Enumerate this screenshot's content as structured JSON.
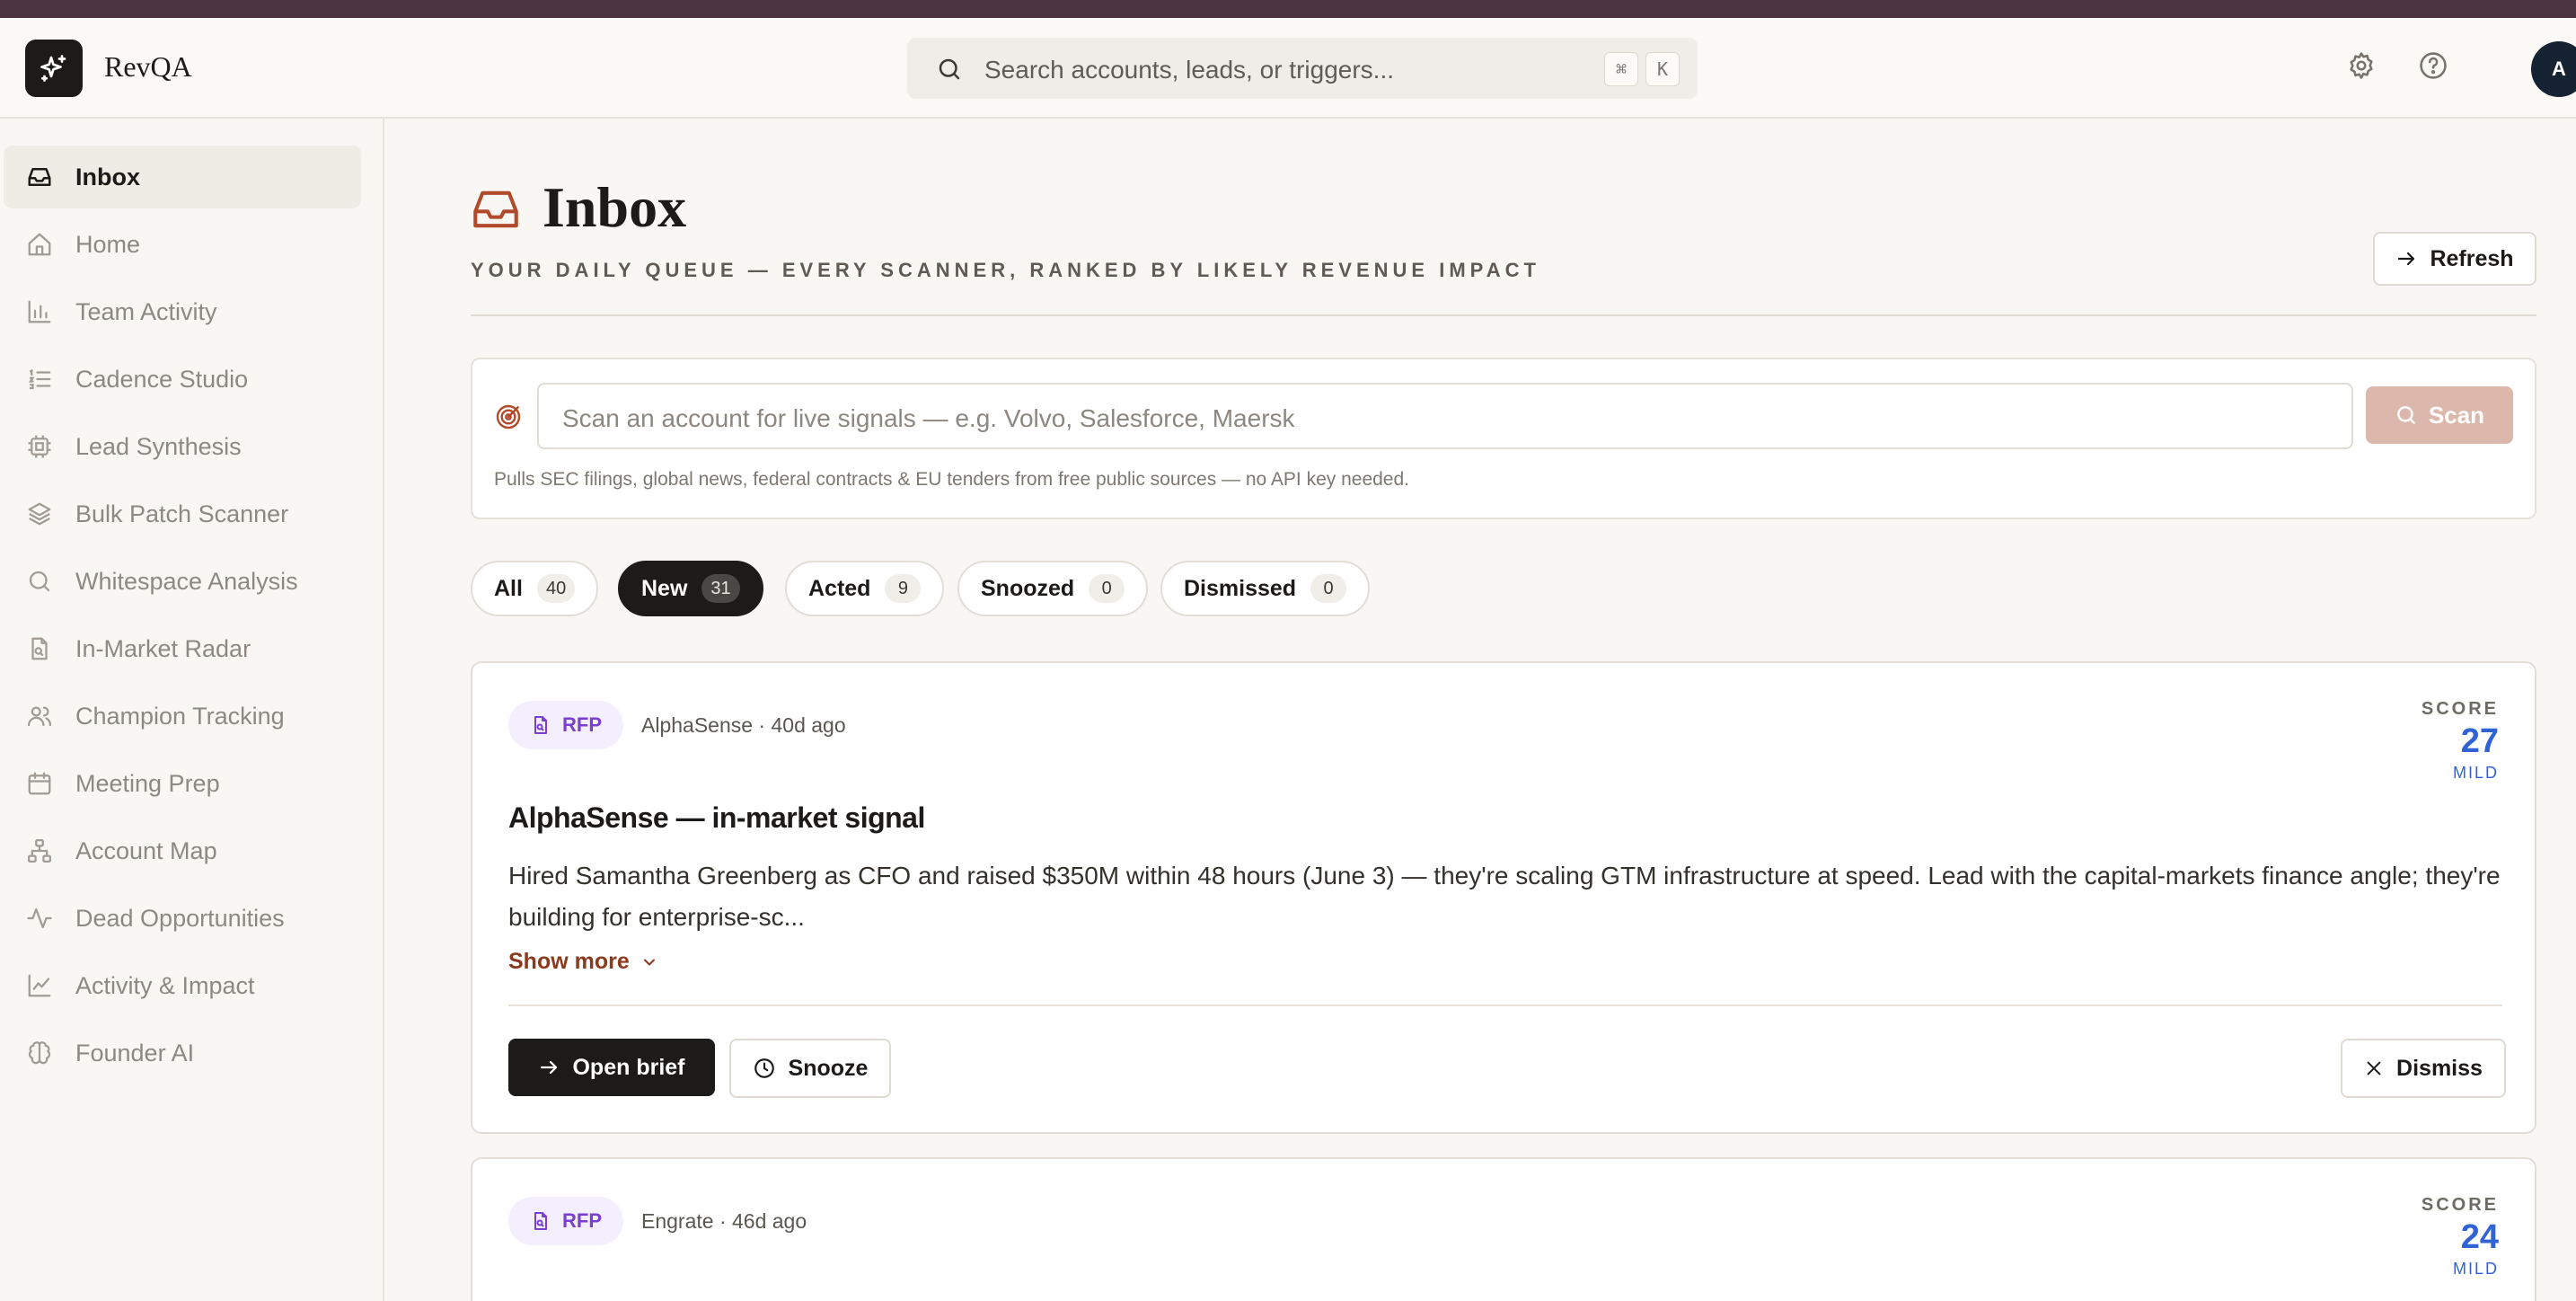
{
  "app": {
    "name": "RevQA"
  },
  "search": {
    "placeholder": "Search accounts, leads, or triggers...",
    "kbd_mod": "⌘",
    "kbd_key": "K"
  },
  "user": {
    "initial": "A"
  },
  "sidebar": {
    "items": [
      {
        "label": "Inbox",
        "icon": "inbox-icon"
      },
      {
        "label": "Home",
        "icon": "home-icon"
      },
      {
        "label": "Team Activity",
        "icon": "bar-chart-icon"
      },
      {
        "label": "Cadence Studio",
        "icon": "list-ordered-icon"
      },
      {
        "label": "Lead Synthesis",
        "icon": "cpu-icon"
      },
      {
        "label": "Bulk Patch Scanner",
        "icon": "layers-icon"
      },
      {
        "label": "Whitespace Analysis",
        "icon": "search-icon"
      },
      {
        "label": "In-Market Radar",
        "icon": "file-search-icon"
      },
      {
        "label": "Champion Tracking",
        "icon": "users-icon"
      },
      {
        "label": "Meeting Prep",
        "icon": "calendar-icon"
      },
      {
        "label": "Account Map",
        "icon": "network-icon"
      },
      {
        "label": "Dead Opportunities",
        "icon": "activity-icon"
      },
      {
        "label": "Activity & Impact",
        "icon": "line-chart-icon"
      },
      {
        "label": "Founder AI",
        "icon": "brain-icon"
      }
    ]
  },
  "page": {
    "title": "Inbox",
    "subtitle": "YOUR DAILY QUEUE — EVERY SCANNER, RANKED BY LIKELY REVENUE IMPACT",
    "refresh_label": "Refresh"
  },
  "scan": {
    "placeholder": "Scan an account for live signals — e.g. Volvo, Salesforce, Maersk",
    "button_label": "Scan",
    "note": "Pulls SEC filings, global news, federal contracts & EU tenders from free public sources — no API key needed."
  },
  "tabs": [
    {
      "label": "All",
      "count": "40"
    },
    {
      "label": "New",
      "count": "31"
    },
    {
      "label": "Acted",
      "count": "9"
    },
    {
      "label": "Snoozed",
      "count": "0"
    },
    {
      "label": "Dismissed",
      "count": "0"
    }
  ],
  "colors": {
    "accent": "#8a3b1d",
    "score": "#2f63d6",
    "badge": "#7a3fd0",
    "primary": "#1c1b1a"
  },
  "cards": [
    {
      "badge": "RFP",
      "meta": "AlphaSense · 40d ago",
      "score_label": "SCORE",
      "score": "27",
      "tier": "MILD",
      "title": "AlphaSense — in-market signal",
      "body": "Hired Samantha Greenberg as CFO and raised $350M within 48 hours (June 3) — they're scaling GTM infrastructure at speed. Lead with the capital-markets finance angle; they're building for enterprise-sc...",
      "show_more": "Show more",
      "open_label": "Open brief",
      "snooze_label": "Snooze",
      "dismiss_label": "Dismiss"
    },
    {
      "badge": "RFP",
      "meta": "Engrate · 46d ago",
      "score_label": "SCORE",
      "score": "24",
      "tier": "MILD"
    }
  ]
}
